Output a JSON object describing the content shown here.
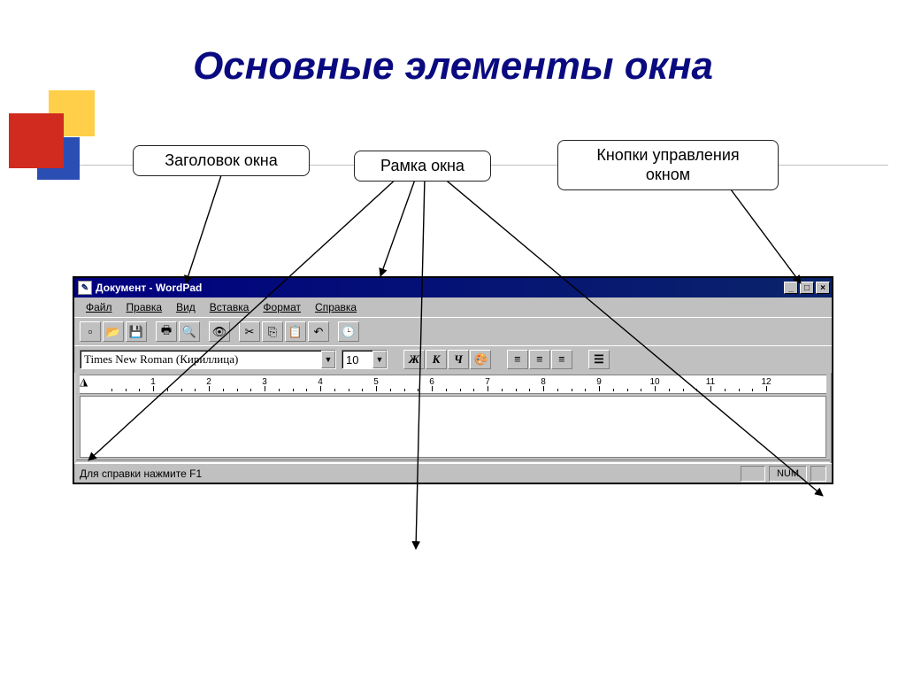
{
  "slide": {
    "title": "Основные элементы окна"
  },
  "callouts": {
    "title_bar": "Заголовок окна",
    "window_frame": "Рамка окна",
    "control_buttons": "Кнопки управления окном"
  },
  "window": {
    "title": "Документ - WordPad",
    "menus": [
      "Файл",
      "Правка",
      "Вид",
      "Вставка",
      "Формат",
      "Справка"
    ],
    "font_name": "Times New Roman (Кириллица)",
    "font_size": "10",
    "format_buttons": {
      "bold": "Ж",
      "italic": "К",
      "underline": "Ч"
    },
    "ruler_numbers": [
      "1",
      "2",
      "3",
      "4",
      "5",
      "6",
      "7",
      "8",
      "9",
      "10",
      "11",
      "12"
    ],
    "status_text": "Для справки нажмите F1",
    "status_num": "NUM"
  }
}
